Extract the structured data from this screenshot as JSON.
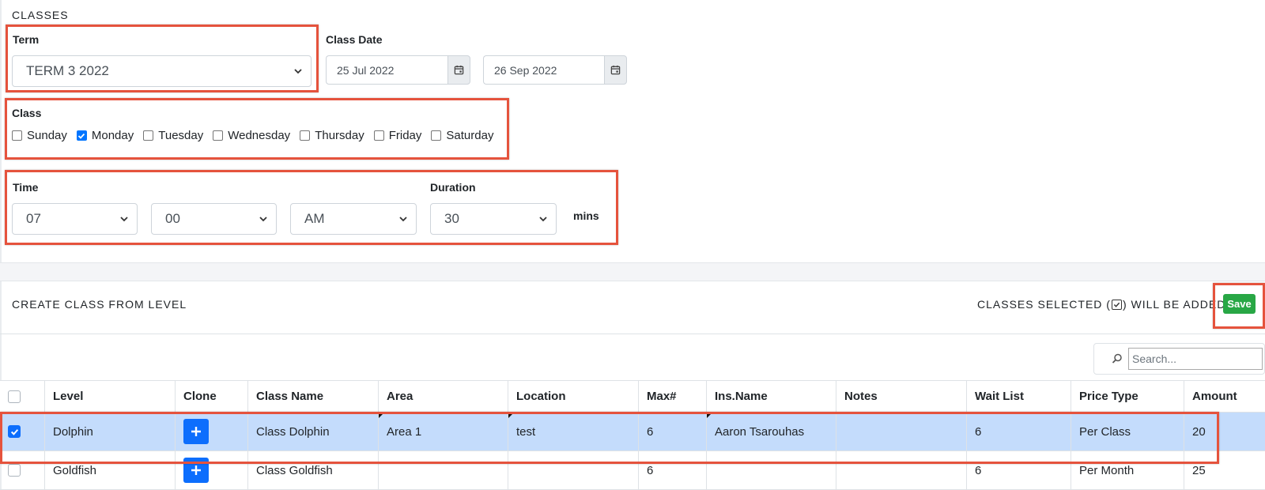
{
  "classes_section": {
    "title": "CLASSES",
    "term_label": "Term",
    "term_value": "TERM 3 2022",
    "class_date_label": "Class Date",
    "date_start": "25 Jul 2022",
    "date_end": "26 Sep 2022",
    "class_label": "Class",
    "days": [
      {
        "label": "Sunday",
        "checked": false
      },
      {
        "label": "Monday",
        "checked": true
      },
      {
        "label": "Tuesday",
        "checked": false
      },
      {
        "label": "Wednesday",
        "checked": false
      },
      {
        "label": "Thursday",
        "checked": false
      },
      {
        "label": "Friday",
        "checked": false
      },
      {
        "label": "Saturday",
        "checked": false
      }
    ],
    "time_label": "Time",
    "hour": "07",
    "minute": "00",
    "ampm": "AM",
    "duration_label": "Duration",
    "duration": "30",
    "duration_unit": "mins"
  },
  "create_section": {
    "title": "CREATE CLASS FROM LEVEL",
    "notice_prefix": "CLASSES SELECTED (",
    "notice_suffix": ") WILL BE ADDED",
    "save_label": "Save",
    "search_placeholder": "Search..."
  },
  "table": {
    "columns": [
      "Level",
      "Clone",
      "Class Name",
      "Area",
      "Location",
      "Max#",
      "Ins.Name",
      "Notes",
      "Wait List",
      "Price Type",
      "Amount"
    ],
    "rows": [
      {
        "checked": true,
        "level": "Dolphin",
        "class_name": "Class Dolphin",
        "area": "Area 1",
        "location": "test",
        "max": "6",
        "ins_name": "Aaron Tsarouhas",
        "notes": "",
        "wait_list": "6",
        "price_type": "Per Class",
        "amount": "20"
      },
      {
        "checked": false,
        "level": "Goldfish",
        "class_name": "Class Goldfish",
        "area": "",
        "location": "",
        "max": "6",
        "ins_name": "",
        "notes": "",
        "wait_list": "6",
        "price_type": "Per Month",
        "amount": "25"
      }
    ]
  },
  "colors": {
    "highlight": "#e5533d",
    "save": "#28a745",
    "clone": "#0d6efd",
    "selected_row": "#c4dcfc"
  }
}
